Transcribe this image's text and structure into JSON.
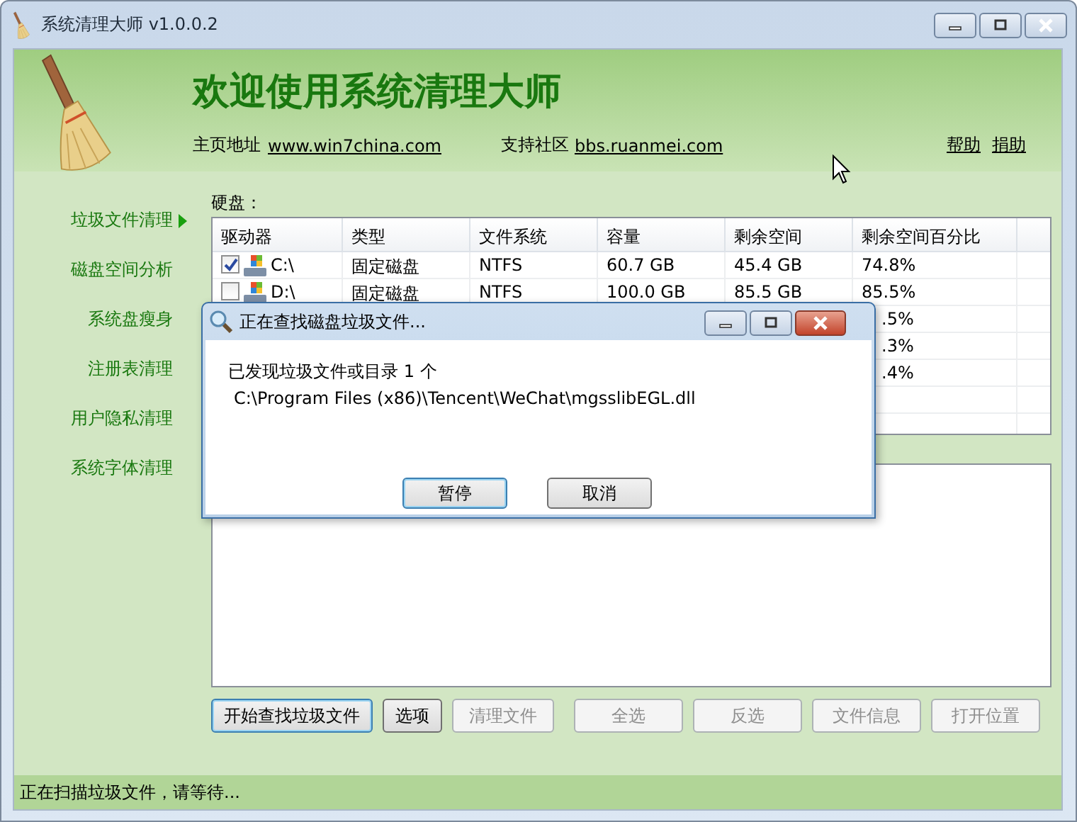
{
  "window": {
    "title": "系统清理大师 v1.0.0.2"
  },
  "header": {
    "heading": "欢迎使用系统清理大师",
    "homepage_label": "主页地址",
    "homepage_link": "www.win7china.com",
    "community_label": "支持社区",
    "community_link": "bbs.ruanmei.com",
    "links": [
      "帮助",
      "捐助"
    ]
  },
  "sidebar": {
    "items": [
      {
        "label": "垃圾文件清理",
        "selected": true
      },
      {
        "label": "磁盘空间分析",
        "selected": false
      },
      {
        "label": "系统盘瘦身",
        "selected": false
      },
      {
        "label": "注册表清理",
        "selected": false
      },
      {
        "label": "用户隐私清理",
        "selected": false
      },
      {
        "label": "系统字体清理",
        "selected": false
      }
    ]
  },
  "disk_label": "硬盘：",
  "table": {
    "columns": [
      "驱动器",
      "类型",
      "文件系统",
      "容量",
      "剩余空间",
      "剩余空间百分比"
    ],
    "rows": [
      {
        "kind": "drive",
        "checked": true,
        "cells": [
          "C:\\",
          "固定磁盘",
          "NTFS",
          "60.7 GB",
          "45.4 GB",
          "74.8%"
        ]
      },
      {
        "kind": "drive",
        "checked": false,
        "cells": [
          "D:\\",
          "固定磁盘",
          "NTFS",
          "100.0 GB",
          "85.5 GB",
          "85.5%"
        ]
      },
      {
        "kind": "covered",
        "cells": [
          ".5%"
        ]
      },
      {
        "kind": "covered",
        "cells": [
          ".3%"
        ]
      },
      {
        "kind": "covered",
        "cells": [
          ".4%"
        ]
      }
    ]
  },
  "buttons": [
    {
      "label": "开始查找垃圾文件",
      "disabled": false,
      "focused": true
    },
    {
      "label": "选项",
      "disabled": false,
      "focused": false
    },
    {
      "label": "清理文件",
      "disabled": true,
      "focused": false
    },
    {
      "label": "全选",
      "disabled": true,
      "focused": false
    },
    {
      "label": "反选",
      "disabled": true,
      "focused": false
    },
    {
      "label": "文件信息",
      "disabled": true,
      "focused": false
    },
    {
      "label": "打开位置",
      "disabled": true,
      "focused": false
    }
  ],
  "status_bar": "正在扫描垃圾文件，请等待...",
  "dialog": {
    "title": "正在查找磁盘垃圾文件...",
    "message": "已发现垃圾文件或目录 1 个",
    "path": "C:\\Program Files (x86)\\Tencent\\WeChat\\mgsslibEGL.dll",
    "buttons": [
      {
        "label": "暂停",
        "focused": true
      },
      {
        "label": "取消",
        "focused": false
      }
    ]
  }
}
